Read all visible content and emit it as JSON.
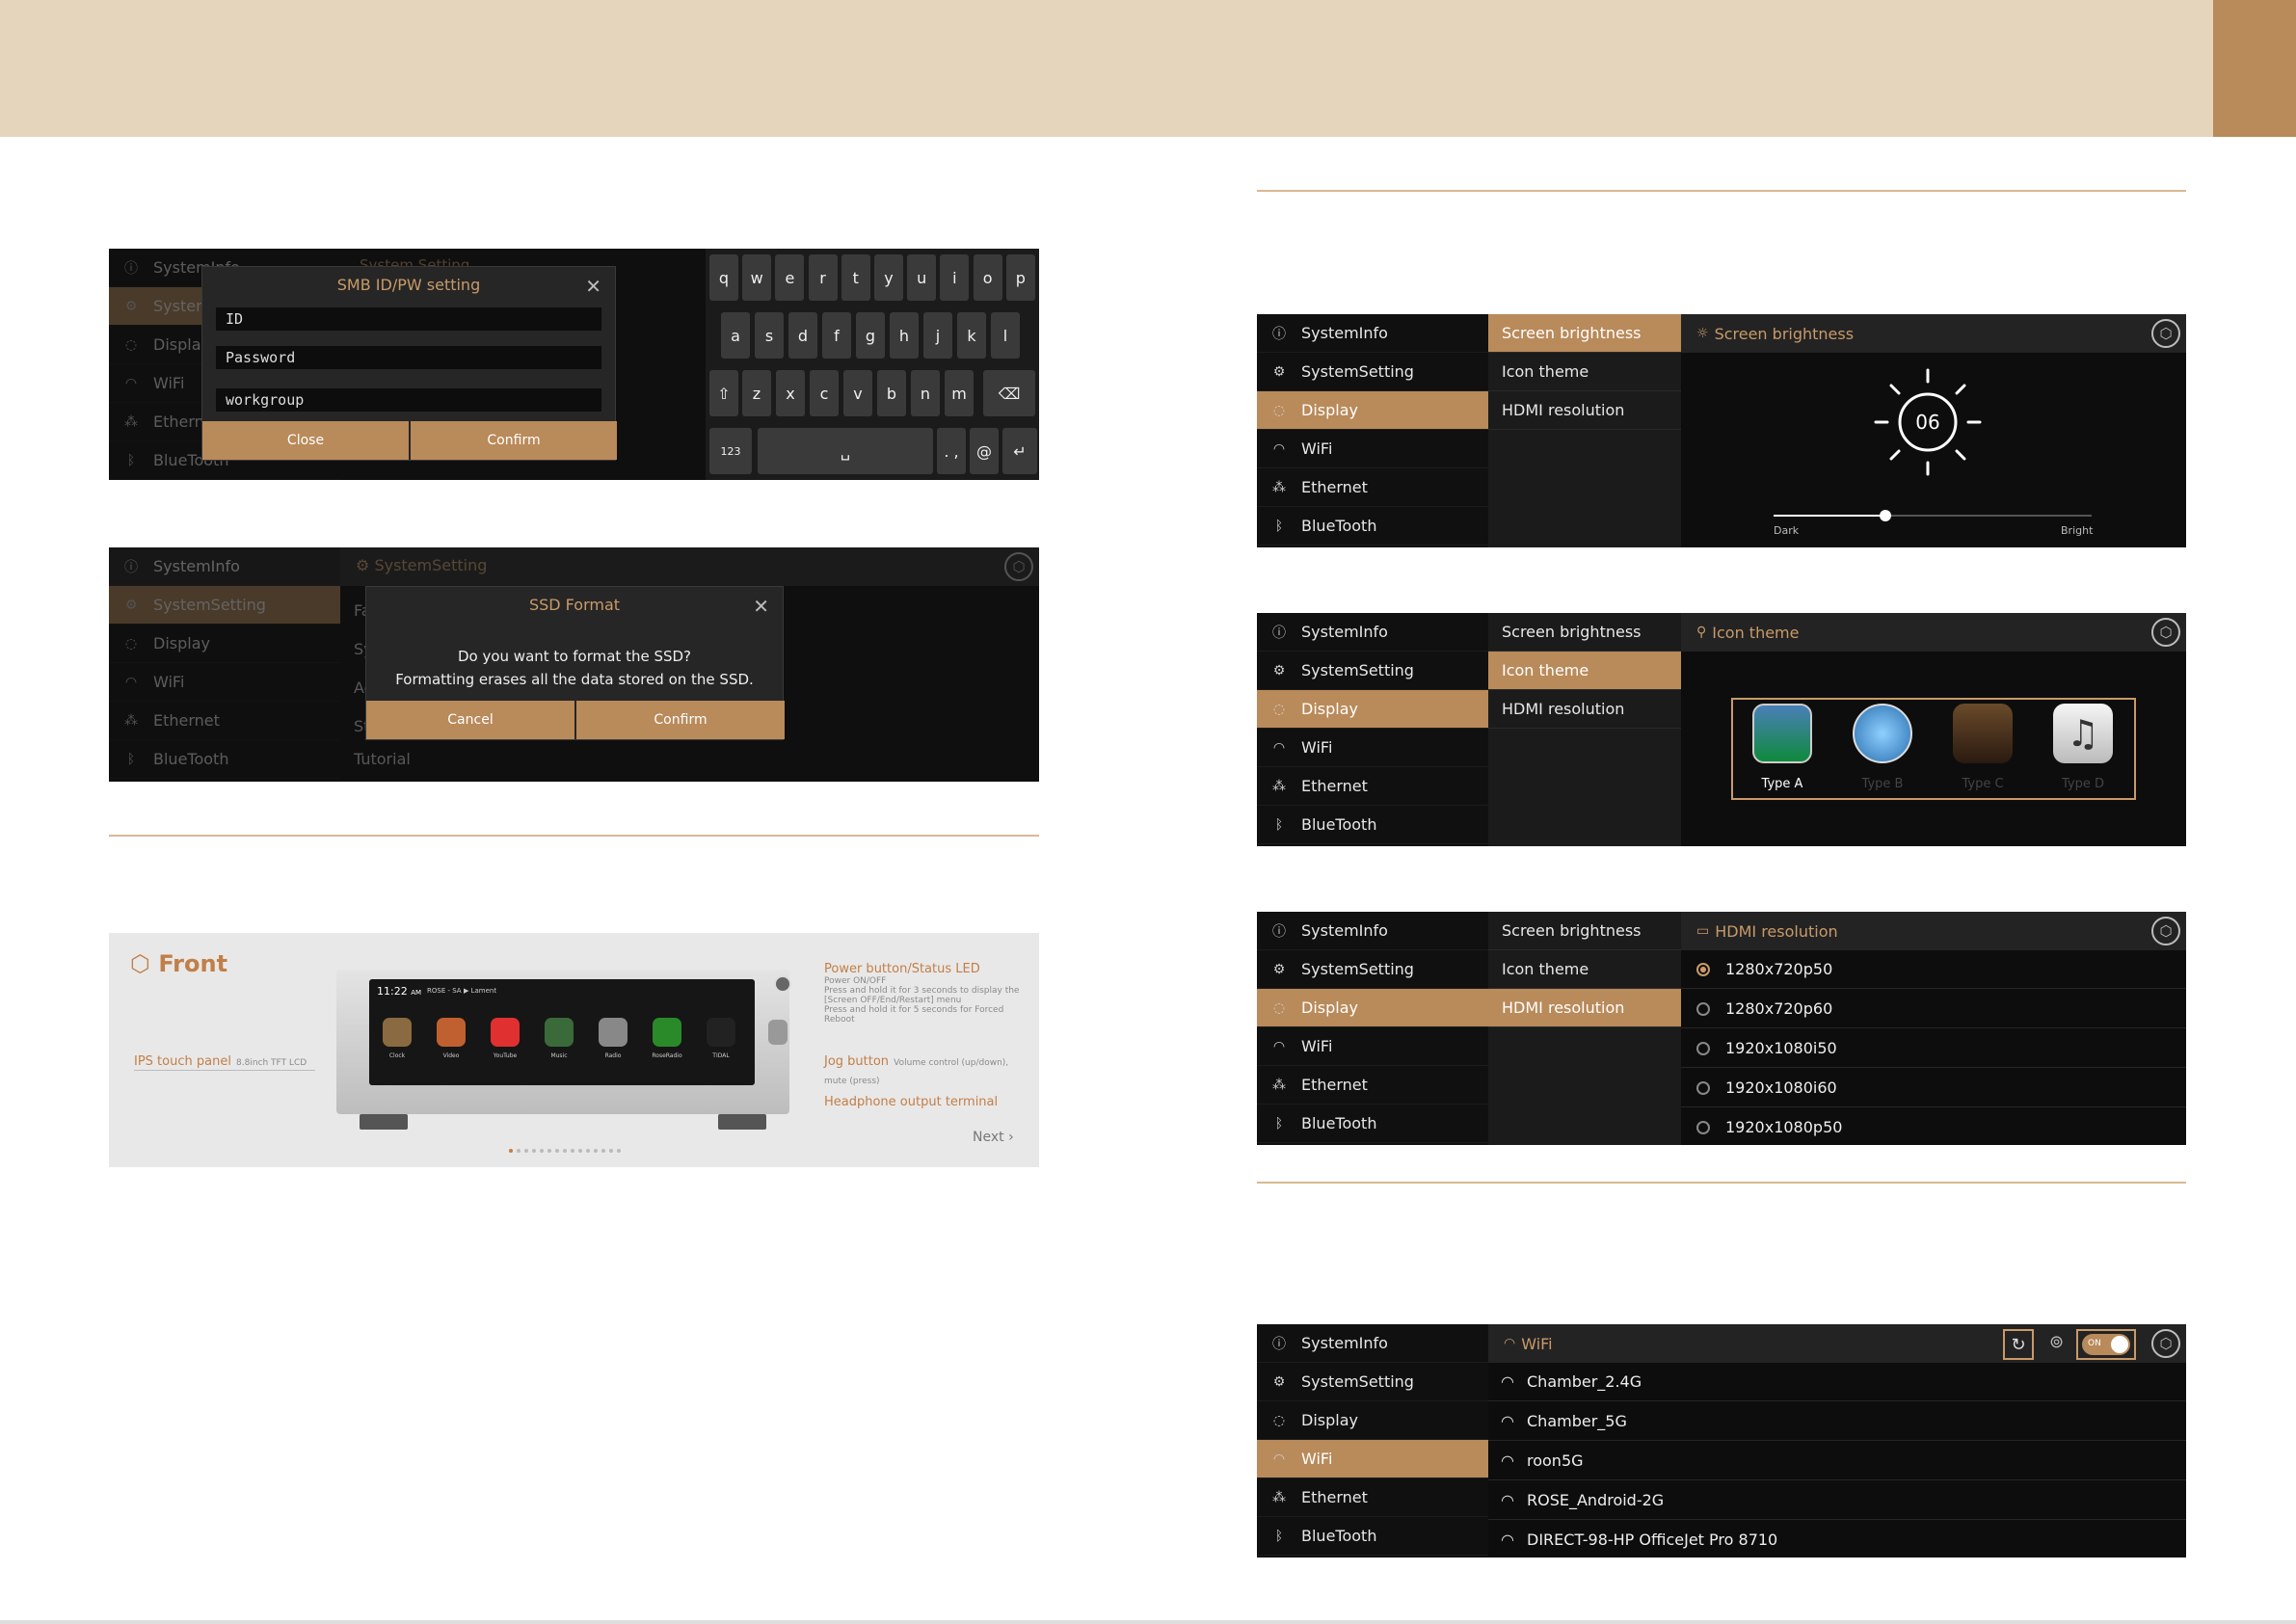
{
  "nav": [
    "SystemInfo",
    "SystemSetting",
    "Display",
    "WiFi",
    "Ethernet",
    "BlueTooth"
  ],
  "display_sub": [
    "Screen brightness",
    "Icon theme",
    "HDMI resolution"
  ],
  "smb": {
    "title": "SMB ID/PW setting",
    "fields": [
      "ID",
      "Password",
      "workgroup"
    ],
    "close": "Close",
    "confirm": "Confirm",
    "bg_header": "System Setting",
    "keyboard": {
      "row1": [
        "q",
        "w",
        "e",
        "r",
        "t",
        "y",
        "u",
        "i",
        "o",
        "p"
      ],
      "row2": [
        "a",
        "s",
        "d",
        "f",
        "g",
        "h",
        "j",
        "k",
        "l"
      ],
      "row3": [
        "z",
        "x",
        "c",
        "v",
        "b",
        "n",
        "m"
      ],
      "num": "123",
      "space": "␣",
      "punct": ". ,",
      "at": "@"
    }
  },
  "ssd": {
    "header": "SystemSetting",
    "title": "SSD Format",
    "line1": "Do you want to format the SSD?",
    "line2": "Formatting erases all the data stored on the SSD.",
    "cancel": "Cancel",
    "confirm": "Confirm",
    "bg_rows": [
      "Fa",
      "Sy",
      "Ac",
      "St",
      "Tutorial"
    ]
  },
  "front": {
    "title": "Front",
    "ips": "IPS touch panel",
    "ips_sub": "8.8inch TFT LCD",
    "power": "Power button/Status LED",
    "power_1": "Power ON/OFF",
    "power_2": "Press and hold it for 3 seconds to display the",
    "power_3": "[Screen OFF/End/Restart] menu",
    "power_4": "Press and hold it for 5 seconds for Forced Reboot",
    "jog": "Jog button",
    "jog_sub": "Volume control (up/down), mute (press)",
    "headphone": "Headphone output terminal",
    "next": "Next",
    "screen_time": "11:22",
    "screen_ampm": "AM",
    "screen_device": "ROSE - SA",
    "screen_song": "Lament",
    "apps": [
      "Clock",
      "Video",
      "YouTube",
      "Music",
      "Radio",
      "RoseRadio",
      "TIDAL"
    ]
  },
  "brightness": {
    "header": "Screen brightness",
    "value": "06",
    "level_fraction": 0.35,
    "dark": "Dark",
    "bright": "Bright"
  },
  "icon_theme": {
    "header": "Icon theme",
    "types": [
      "Type A",
      "Type B",
      "Type C",
      "Type D"
    ]
  },
  "hdmi": {
    "header": "HDMI resolution",
    "options": [
      "1280x720p50",
      "1280x720p60",
      "1920x1080i50",
      "1920x1080i60",
      "1920x1080p50"
    ],
    "selected": 0
  },
  "wifi": {
    "header": "WiFi",
    "toggle": "ON",
    "networks": [
      "Chamber_2.4G",
      "Chamber_5G",
      "roon5G",
      "ROSE_Android-2G",
      "DIRECT-98-HP OfficeJet Pro 8710"
    ]
  },
  "colors": {
    "accent": "#b98a5a",
    "band": "#e6d5bd",
    "label": "#c99a68"
  }
}
